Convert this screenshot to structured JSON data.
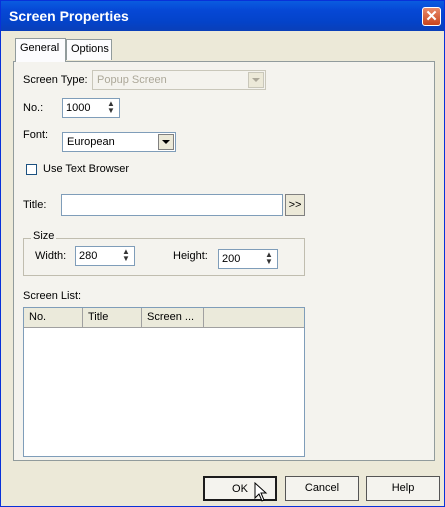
{
  "window": {
    "title": "Screen Properties",
    "close_glyph": "✕"
  },
  "tabs": [
    {
      "label": "General",
      "active": true
    },
    {
      "label": "Options",
      "active": false
    }
  ],
  "form": {
    "screen_type_label": "Screen Type:",
    "screen_type_value": "Popup Screen",
    "no_label": "No.:",
    "no_value": "1000",
    "font_label": "Font:",
    "font_value": "European",
    "use_text_browser_label": "Use Text Browser",
    "use_text_browser_checked": false,
    "title_label": "Title:",
    "title_value": "",
    "title_button": ">>",
    "size_group_label": "Size",
    "width_label": "Width:",
    "width_value": "280",
    "height_label": "Height:",
    "height_value": "200",
    "screen_list_label": "Screen List:"
  },
  "screen_list": {
    "columns": [
      "No.",
      "Title",
      "Screen ..."
    ],
    "rows": []
  },
  "buttons": {
    "ok": "OK",
    "cancel": "Cancel",
    "help": "Help"
  }
}
